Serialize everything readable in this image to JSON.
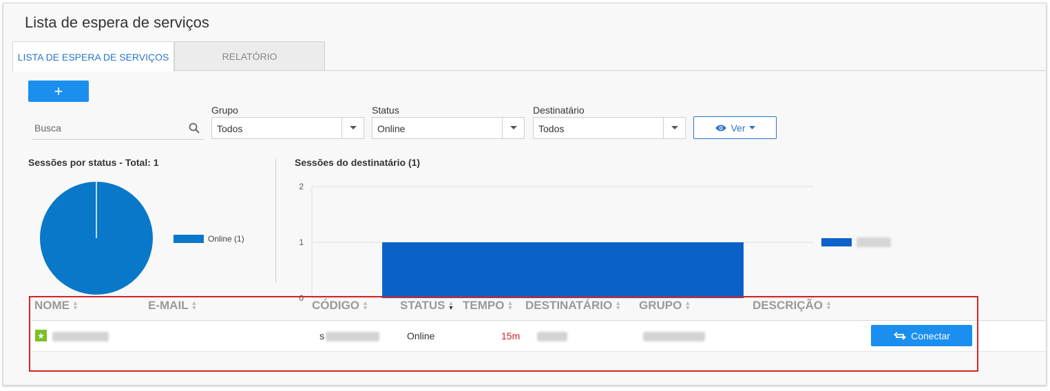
{
  "page": {
    "title": "Lista de espera de serviços"
  },
  "tabs": [
    {
      "label": "LISTA DE ESPERA DE SERVIÇOS",
      "active": true
    },
    {
      "label": "RELATÓRIO",
      "active": false
    }
  ],
  "toolbar": {
    "add_label": "+"
  },
  "filters": {
    "search_placeholder": "Busca",
    "grupo": {
      "label": "Grupo",
      "value": "Todos"
    },
    "status": {
      "label": "Status",
      "value": "Online"
    },
    "destinatario": {
      "label": "Destinatário",
      "value": "Todos"
    },
    "ver_label": "Ver"
  },
  "charts": {
    "status_title": "Sessões por status - Total: 1",
    "dest_title": "Sessões do destinatário (1)"
  },
  "chart_data": [
    {
      "type": "pie",
      "title": "Sessões por status - Total: 1",
      "slices": [
        {
          "label": "Online (1)",
          "value": 1,
          "color": "#0a78c9"
        }
      ],
      "legend_position": "right"
    },
    {
      "type": "bar",
      "title": "Sessões do destinatário (1)",
      "categories": [
        ""
      ],
      "series": [
        {
          "values": [
            1
          ],
          "color": "#0a62c9"
        }
      ],
      "ylim": [
        0,
        2
      ],
      "yticks": [
        "0",
        "1",
        "2"
      ],
      "grid": true,
      "legend_position": "right"
    }
  ],
  "table": {
    "columns": [
      "NOME",
      "E-MAIL",
      "CÓDIGO",
      "STATUS",
      "TEMPO",
      "DESTINATÁRIO",
      "GRUPO",
      "DESCRIÇÃO"
    ],
    "rows": [
      {
        "code_prefix": "s",
        "status": "Online",
        "time": "15m",
        "action": "Conectar"
      }
    ]
  },
  "colors": {
    "accent": "#1a8ff0",
    "tab_active": "#2a74c9",
    "time_red": "#d32222",
    "highlight": "#d32222",
    "star": "#7cbf2a"
  }
}
